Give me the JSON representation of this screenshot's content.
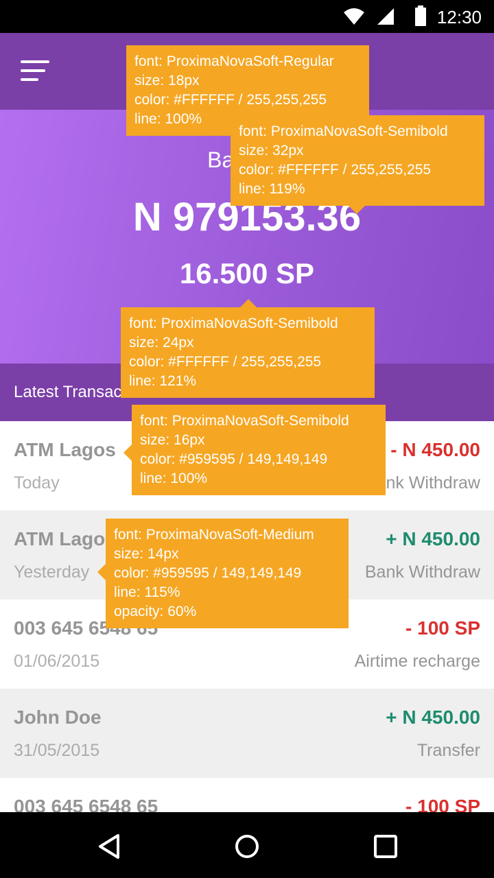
{
  "status_bar": {
    "time": "12:30"
  },
  "hero": {
    "balance_label": "Balance",
    "balance_amount": "N 979153.36",
    "points": "16.500 SP"
  },
  "section_header": {
    "title": "Latest Transactions"
  },
  "transactions": [
    {
      "name": "ATM Lagos",
      "date": "Today",
      "amount": "- N 450.00",
      "type": "Bank Withdraw",
      "direction": "negative"
    },
    {
      "name": "ATM Lagos",
      "date": "Yesterday",
      "amount": "+ N 450.00",
      "type": "Bank Withdraw",
      "direction": "positive"
    },
    {
      "name": "003 645 6548 65",
      "date": "01/06/2015",
      "amount": "- 100 SP",
      "type": "Airtime recharge",
      "direction": "negative"
    },
    {
      "name": "John Doe",
      "date": "31/05/2015",
      "amount": "+ N 450.00",
      "type": "Transfer",
      "direction": "positive"
    },
    {
      "name": "003 645 6548 65",
      "date": "",
      "amount": "- 100 SP",
      "type": "",
      "direction": "negative"
    }
  ],
  "annotations": [
    {
      "lines": [
        "font: ProximaNovaSoft-Regular",
        "size: 18px",
        "color: #FFFFFF / 255,255,255",
        "line: 100%"
      ]
    },
    {
      "lines": [
        "font: ProximaNovaSoft-Semibold",
        "size: 32px",
        "color: #FFFFFF / 255,255,255",
        "line: 119%"
      ]
    },
    {
      "lines": [
        "font: ProximaNovaSoft-Semibold",
        "size: 24px",
        "color: #FFFFFF / 255,255,255",
        "line: 121%"
      ]
    },
    {
      "lines": [
        "font: ProximaNovaSoft-Semibold",
        "size: 16px",
        "color: #959595 / 149,149,149",
        "line: 100%"
      ]
    },
    {
      "lines": [
        "font: ProximaNovaSoft-Medium",
        "size: 14px",
        "color: #959595 / 149,149,149",
        "line: 115%",
        "opacity: 60%"
      ]
    }
  ],
  "colors": {
    "primary": "#7b3fa8",
    "hero_gradient_start": "#b36ff0",
    "negative": "#d9312f",
    "positive": "#1e8c6e",
    "text_muted": "#959595",
    "annotation": "#f5a623"
  },
  "icons": [
    "wifi-icon",
    "cellular-signal-icon",
    "battery-icon",
    "menu-icon",
    "back-icon",
    "home-icon",
    "recents-icon"
  ]
}
